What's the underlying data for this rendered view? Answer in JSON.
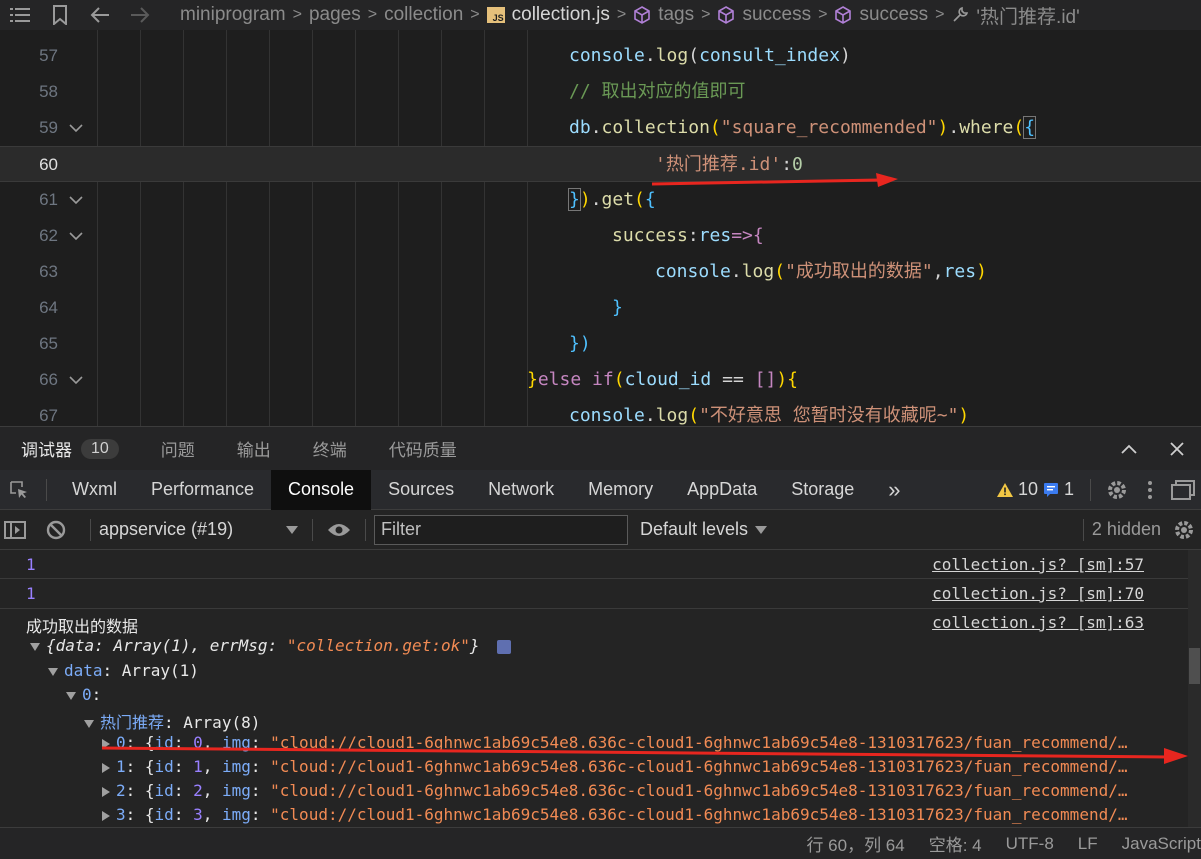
{
  "breadcrumb": {
    "items": [
      "miniprogram",
      "pages",
      "collection",
      "collection.js",
      "tags",
      "success",
      "success",
      "'热门推荐.id'"
    ]
  },
  "editor": {
    "lines": [
      {
        "num": "57"
      },
      {
        "num": "58"
      },
      {
        "num": "59"
      },
      {
        "num": "60"
      },
      {
        "num": "61"
      },
      {
        "num": "62"
      },
      {
        "num": "63"
      },
      {
        "num": "64"
      },
      {
        "num": "65"
      },
      {
        "num": "66"
      },
      {
        "num": "67"
      }
    ],
    "code": {
      "l57": {
        "obj": "console",
        "dot": ".",
        "fn": "log",
        "open": "(",
        "arg": "consult_index",
        "close": ")"
      },
      "l58": {
        "comment": "// 取出对应的值即可"
      },
      "l59": {
        "obj": "db",
        "dot": ".",
        "fn1": "collection",
        "open1": "(",
        "str": "\"square_recommended\"",
        "close1": ")",
        "dot2": ".",
        "fn2": "where",
        "open2": "(",
        "brace": "{"
      },
      "l60": {
        "key": "'热门推荐.id'",
        "colon": ":",
        "val": "0"
      },
      "l61": {
        "brace": "}",
        "close": ")",
        "dot": ".",
        "fn": "get",
        "open": "(",
        "brace2": "{"
      },
      "l62": {
        "key": "success",
        "colon": ":",
        "param": "res",
        "arrow": "=>",
        "brace": "{"
      },
      "l63": {
        "obj": "console",
        "dot": ".",
        "fn": "log",
        "open": "(",
        "str": "\"成功取出的数据\"",
        "comma": ",",
        "arg": "res",
        "close": ")"
      },
      "l64": {
        "brace": "}"
      },
      "l65": {
        "close": "})"
      },
      "l66": {
        "brace": "}",
        "kw1": "else",
        "kw2": "if",
        "open": "(",
        "var": "cloud_id",
        "op": " == ",
        "arr": "[]",
        "close": ")",
        "brace2": "{"
      },
      "l67": {
        "obj": "console",
        "dot": ".",
        "fn": "log",
        "open": "(",
        "str": "\"不好意思 您暂时没有收藏呢~\"",
        "close": ")"
      }
    }
  },
  "panel_tabs": [
    {
      "label": "调试器",
      "badge": "10"
    },
    {
      "label": "问题"
    },
    {
      "label": "输出"
    },
    {
      "label": "终端"
    },
    {
      "label": "代码质量"
    }
  ],
  "devtools_tabs": [
    "Wxml",
    "Performance",
    "Console",
    "Sources",
    "Network",
    "Memory",
    "AppData",
    "Storage"
  ],
  "devtools_more": "»",
  "warnings": {
    "warn_count": "10",
    "info_count": "1",
    "warn_color": "#f2c744",
    "info_color": "#3b7bf0"
  },
  "console_toolbar": {
    "context": "appservice (#19)",
    "filter_placeholder": "Filter",
    "levels": "Default levels",
    "hidden": "2 hidden"
  },
  "console": {
    "rows": [
      {
        "value": "1",
        "source": "collection.js? [sm]:57"
      },
      {
        "value": "1",
        "source": "collection.js? [sm]:70"
      },
      {
        "value": "成功取出的数据",
        "source": "collection.js? [sm]:63"
      }
    ],
    "obj_line": {
      "open": "{",
      "k1": "data",
      "c1": ": ",
      "v1": "Array(1)",
      "sep1": ", ",
      "k2": "errMsg",
      "c2": ": ",
      "v2": "\"collection.get:ok\"",
      "close": "}"
    },
    "data_line": {
      "key": "data",
      "colon": ": ",
      "val": "Array(1)"
    },
    "idx0": {
      "key": "0",
      "colon": ":"
    },
    "hot_line": {
      "key": "热门推荐",
      "colon": ": ",
      "val": "Array(8)"
    },
    "items": [
      {
        "idx": "0",
        "id": "0",
        "img": "\"cloud://cloud1-6ghnwc1ab69c54e8.636c-cloud1-6ghnwc1ab69c54e8-1310317623/fuan_recommend/…"
      },
      {
        "idx": "1",
        "id": "1",
        "img": "\"cloud://cloud1-6ghnwc1ab69c54e8.636c-cloud1-6ghnwc1ab69c54e8-1310317623/fuan_recommend/…"
      },
      {
        "idx": "2",
        "id": "2",
        "img": "\"cloud://cloud1-6ghnwc1ab69c54e8.636c-cloud1-6ghnwc1ab69c54e8-1310317623/fuan_recommend/…"
      },
      {
        "idx": "3",
        "id": "3",
        "img": "\"cloud://cloud1-6ghnwc1ab69c54e8.636c-cloud1-6ghnwc1ab69c54e8-1310317623/fuan_recommend/…"
      }
    ],
    "item_labels": {
      "open": "{",
      "id_key": "id",
      "img_key": "img",
      "colon": ": ",
      "comma": ", "
    }
  },
  "statusbar": {
    "position": "行 60，列 64",
    "spaces": "空格: 4",
    "encoding": "UTF-8",
    "eol": "LF",
    "language": "JavaScript"
  },
  "annotation_color": "#e8261f"
}
